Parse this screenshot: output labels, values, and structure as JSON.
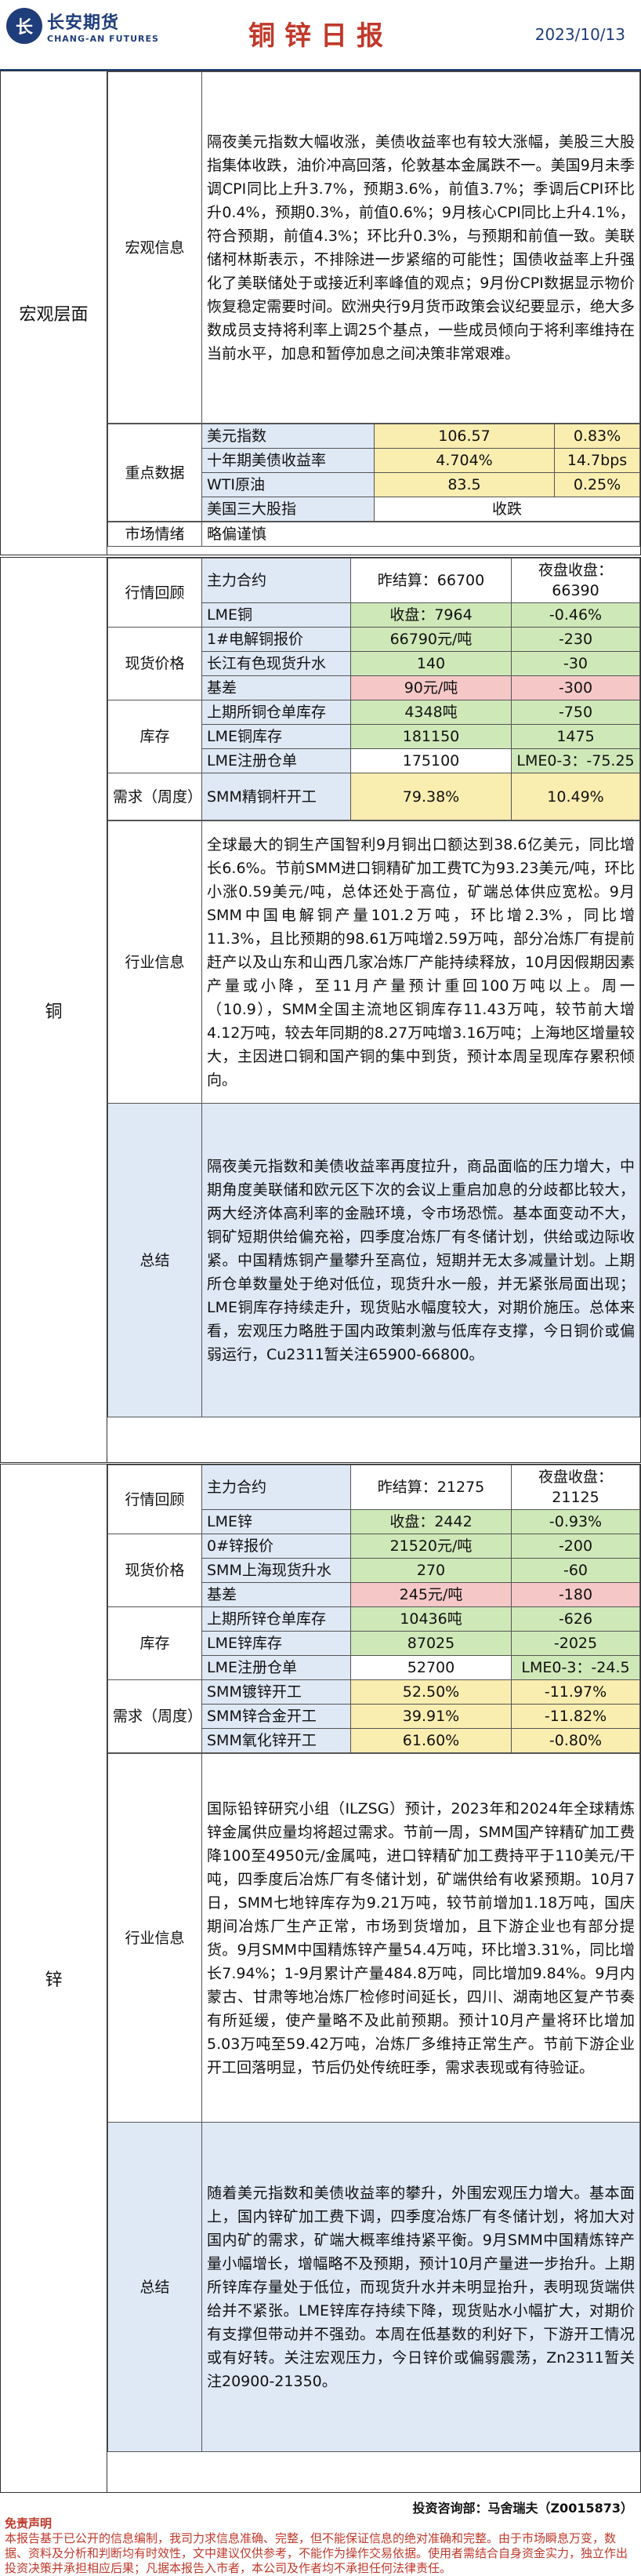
{
  "header": {
    "logo_mark": "长",
    "logo_cn": "长安期货",
    "logo_en": "CHANG-AN FUTURES",
    "title": "铜锌日报",
    "date": "2023/10/13"
  },
  "macro": {
    "side": "宏观层面",
    "info_label": "宏观信息",
    "info_text": "隔夜美元指数大幅收涨，美债收益率也有较大涨幅，美股三大股指集体收跌，油价冲高回落，伦敦基本金属跌不一。美国9月未季调CPI同比上升3.7%，预期3.6%，前值3.7%；季调后CPI环比升0.4%，预期0.3%，前值0.6%；9月核心CPI同比上升4.1%，符合预期，前值4.3%；环比升0.3%，与预期和前值一致。美联储柯林斯表示，不排除进一步紧缩的可能性；国债收益率上升强化了美联储处于或接近利率峰值的观点；9月份CPI数据显示物价恢复稳定需要时间。欧洲央行9月货币政策会议纪要显示，绝大多数成员支持将利率上调25个基点，一些成员倾向于将利率维持在当前水平，加息和暂停加息之间决策非常艰难。",
    "key_label": "重点数据",
    "key_rows": [
      {
        "name": "美元指数",
        "v1": "106.57",
        "v2": "0.83%"
      },
      {
        "name": "十年期美债收益率",
        "v1": "4.704%",
        "v2": "14.7bps"
      },
      {
        "name": "WTI原油",
        "v1": "83.5",
        "v2": "0.25%"
      },
      {
        "name": "美国三大股指",
        "v1": "收跌",
        "v2": ""
      }
    ],
    "sentiment_label": "市场情绪",
    "sentiment_value": "略偏谨慎"
  },
  "copper": {
    "side": "铜",
    "trend_label": "行情回顾",
    "trend_rows": [
      {
        "a": "主力合约",
        "b": "昨结算：66700",
        "c": "夜盘收盘：66390"
      },
      {
        "a": "LME铜",
        "b": "收盘：7964",
        "c": "-0.46%"
      }
    ],
    "spot_label": "现货价格",
    "spot_rows": [
      {
        "a": "1#电解铜报价",
        "b": "66790元/吨",
        "c": "-230"
      },
      {
        "a": "长江有色现货升水",
        "b": "140",
        "c": "-30"
      },
      {
        "a": "基差",
        "b": "90元/吨",
        "c": "-300"
      }
    ],
    "stock_label": "库存",
    "stock_rows": [
      {
        "a": "上期所铜仓单库存",
        "b": "4348吨",
        "c": "-750"
      },
      {
        "a": "LME铜库存",
        "b": "181150",
        "c": "1475"
      },
      {
        "a": "LME注册仓单",
        "b": "175100",
        "c": "LME0-3：-75.25"
      }
    ],
    "demand_label": "需求（周度）",
    "demand_rows": [
      {
        "a": "SMM精铜杆开工",
        "b": "79.38%",
        "c": "10.49%"
      }
    ],
    "industry_label": "行业信息",
    "industry_text": "全球最大的铜生产国智利9月铜出口额达到38.6亿美元，同比增长6.6%。节前SMM进口铜精矿加工费TC为93.23美元/吨，环比小涨0.59美元/吨，总体还处于高位，矿端总体供应宽松。9月SMM中国电解铜产量101.2万吨，环比增2.3%，同比增11.3%，且比预期的98.61万吨增2.59万吨，部分冶炼厂有提前赶产以及山东和山西几家冶炼厂产能持续释放，10月因假期因素产量或小降，至11月产量预计重回100万吨以上。周一（10.9），SMM全国主流地区铜库存11.43万吨，较节前大增4.12万吨，较去年同期的8.27万吨增3.16万吨；上海地区增量较大，主因进口铜和国产铜的集中到货，预计本周呈现库存累积倾向。",
    "summary_label": "总结",
    "summary_text": "隔夜美元指数和美债收益率再度拉升，商品面临的压力增大，中期角度美联储和欧元区下次的会议上重启加息的分歧都比较大，两大经济体高利率的金融环境，令市场恐慌。基本面变动不大，铜矿短期供给偏充裕，四季度冶炼厂有冬储计划，供给或边际收紧。中国精炼铜产量攀升至高位，短期并无太多减量计划。上期所仓单数量处于绝对低位，现货升水一般，并无紧张局面出现；LME铜库存持续走升，现货贴水幅度较大，对期价施压。总体来看，宏观压力略胜于国内政策刺激与低库存支撑，今日铜价或偏弱运行，Cu2311暂关注65900-66800。"
  },
  "zinc": {
    "side": "锌",
    "trend_label": "行情回顾",
    "trend_rows": [
      {
        "a": "主力合约",
        "b": "昨结算：21275",
        "c": "夜盘收盘：21125"
      },
      {
        "a": "LME锌",
        "b": "收盘：2442",
        "c": "-0.93%"
      }
    ],
    "spot_label": "现货价格",
    "spot_rows": [
      {
        "a": "0#锌报价",
        "b": "21520元/吨",
        "c": "-200"
      },
      {
        "a": "SMM上海现货升水",
        "b": "270",
        "c": "-60"
      },
      {
        "a": "基差",
        "b": "245元/吨",
        "c": "-180"
      }
    ],
    "stock_label": "库存",
    "stock_rows": [
      {
        "a": "上期所锌仓单库存",
        "b": "10436吨",
        "c": "-626"
      },
      {
        "a": "LME锌库存",
        "b": "87025",
        "c": "-2025"
      },
      {
        "a": "LME注册仓单",
        "b": "52700",
        "c": "LME0-3：-24.5"
      }
    ],
    "demand_label": "需求（周度）",
    "demand_rows": [
      {
        "a": "SMM镀锌开工",
        "b": "52.50%",
        "c": "-11.97%"
      },
      {
        "a": "SMM锌合金开工",
        "b": "39.91%",
        "c": "-11.82%"
      },
      {
        "a": "SMM氧化锌开工",
        "b": "61.60%",
        "c": "-0.80%"
      }
    ],
    "industry_label": "行业信息",
    "industry_text": "国际铅锌研究小组（ILZSG）预计，2023年和2024年全球精炼锌金属供应量均将超过需求。节前一周，SMM国产锌精矿加工费降100至4950元/金属吨，进口锌精矿加工费持平于110美元/干吨，四季度后冶炼厂有冬储计划，矿端供给有收紧预期。10月7日，SMM七地锌库存为9.21万吨，较节前增加1.18万吨，国庆期间冶炼厂生产正常，市场到货增加，且下游企业也有部分提货。9月SMM中国精炼锌产量54.4万吨，环比增3.31%，同比增长7.94%；1-9月累计产量484.8万吨，同比增加9.84%。9月内蒙古、甘肃等地冶炼厂检修时间延长，四川、湖南地区复产节奏有所延缓，使产量略不及此前预期。预计10月产量将环比增加5.03万吨至59.42万吨，冶炼厂多维持正常生产。节前下游企业开工回落明显，节后仍处传统旺季，需求表现或有待验证。",
    "summary_label": "总结",
    "summary_text": "随着美元指数和美债收益率的攀升，外围宏观压力增大。基本面上，国内锌矿加工费下调，四季度冶炼厂有冬储计划，将加大对国内矿的需求，矿端大概率维持紧平衡。9月SMM中国精炼锌产量小幅增长，增幅略不及预期，预计10月产量进一步抬升。上期所锌库存量处于低位，而现货升水并未明显抬升，表明现货端供给并不紧张。LME锌库存持续下降，现货贴水小幅扩大，对期价有支撑但带动并不强劲。本周在低基数的利好下，下游开工情况或有好转。关注宏观压力，今日锌价或偏弱震荡，Zn2311暂关注20900-21350。"
  },
  "footer": {
    "invest": "投资咨询部：马舍瑞夫（Z0015873）",
    "disclaimer_title": "免责声明",
    "disclaimer": "本报告基于已公开的信息编制，我司力求信息准确、完整，但不能保证信息的绝对准确和完整。由于市场瞬息万变，数据、资料及分析和判断均有时效性，文中建议仅供参考，不能作为操作交易依据。使用者需结合自身资金实力，独立作出投资决策并承担相应后果；凡据本报告入市者，本公司及作者均不承担任何法律责任。"
  }
}
